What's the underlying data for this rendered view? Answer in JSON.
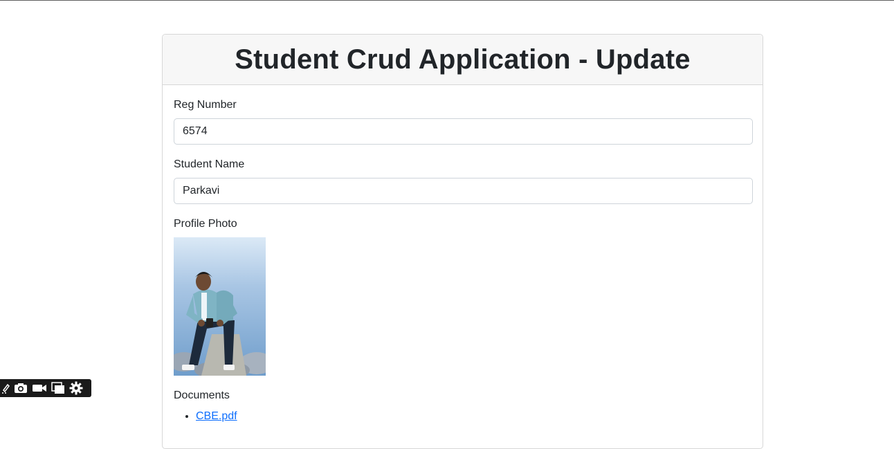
{
  "page": {
    "title": "Student Crud Application - Update"
  },
  "form": {
    "reg_number": {
      "label": "Reg Number",
      "value": "6574"
    },
    "student_name": {
      "label": "Student Name",
      "value": "Parkavi"
    },
    "profile_photo": {
      "label": "Profile Photo"
    },
    "documents": {
      "label": "Documents",
      "files": [
        "CBE.pdf"
      ]
    }
  },
  "toolbar": {
    "icons": [
      "pen-icon",
      "camera-icon",
      "video-icon",
      "window-icon",
      "gear-icon"
    ]
  },
  "colors": {
    "link": "#0d6efd",
    "header_bg": "#f7f7f7",
    "border": "#d7d7d7"
  }
}
